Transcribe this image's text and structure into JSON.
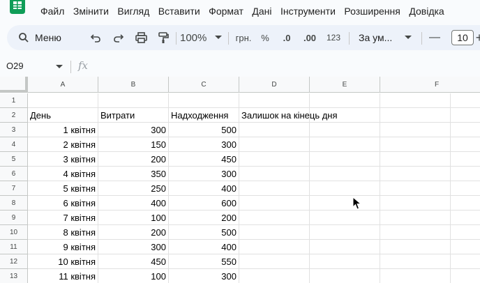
{
  "menu": [
    "Файл",
    "Змінити",
    "Вигляд",
    "Вставити",
    "Формат",
    "Дані",
    "Інструменти",
    "Розширення",
    "Довідка"
  ],
  "toolbar": {
    "search_label": "Меню",
    "zoom": "100%",
    "currency": "грн.",
    "percent": "%",
    "decrease_decimal": ".0",
    "increase_decimal": ".00",
    "number_format": "123",
    "font": "За ум...",
    "minus": "—",
    "font_size": "10",
    "plus": "+"
  },
  "formula_bar": {
    "cell_ref": "O29",
    "fx": "fx"
  },
  "columns": [
    "A",
    "B",
    "C",
    "D",
    "E",
    "F"
  ],
  "rows": [
    "1",
    "2",
    "3",
    "4",
    "5",
    "6",
    "7",
    "8",
    "9",
    "10",
    "11",
    "12",
    "13"
  ],
  "table": {
    "headers": [
      "День",
      "Витрати",
      "Надходження",
      "Залишок на кінець дня"
    ],
    "rows": [
      [
        "1 квітня",
        "300",
        "500"
      ],
      [
        "2 квітня",
        "150",
        "300"
      ],
      [
        "3 квітня",
        "200",
        "450"
      ],
      [
        "4 квітня",
        "350",
        "300"
      ],
      [
        "5 квітня",
        "250",
        "400"
      ],
      [
        "6 квітня",
        "400",
        "600"
      ],
      [
        "7 квітня",
        "100",
        "200"
      ],
      [
        "8 квітня",
        "200",
        "500"
      ],
      [
        "9 квітня",
        "300",
        "400"
      ],
      [
        "10 квітня",
        "450",
        "550"
      ],
      [
        "11 квітня",
        "100",
        "300"
      ]
    ]
  },
  "colors": {
    "accent": "#0b57d0",
    "sheets_green": "#0f9d58",
    "toolbar_bg": "#edf2fa"
  }
}
